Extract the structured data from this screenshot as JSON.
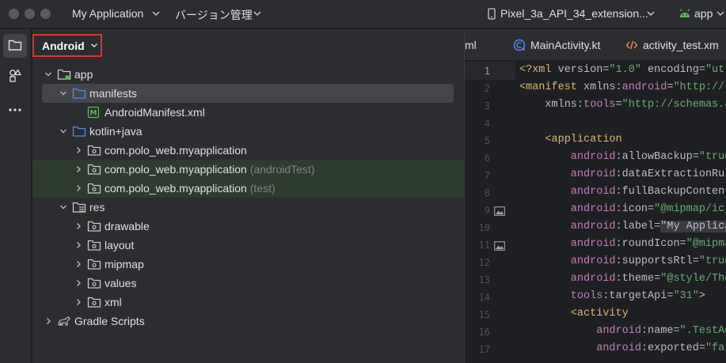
{
  "titlebar": {
    "project_name": "My Application",
    "vcs_label": "バージョン管理",
    "device": "Pixel_3a_API_34_extension...",
    "run_config": "app"
  },
  "project_panel": {
    "view_mode": "Android",
    "tree": [
      {
        "label": "app",
        "suffix": "",
        "indent": 0,
        "expanded": true,
        "icon": "module-folder-icon"
      },
      {
        "label": "manifests",
        "suffix": "",
        "indent": 1,
        "expanded": true,
        "icon": "folder-icon",
        "selected": true
      },
      {
        "label": "AndroidManifest.xml",
        "suffix": "",
        "indent": 2,
        "icon": "manifest-file-icon"
      },
      {
        "label": "kotlin+java",
        "suffix": "",
        "indent": 1,
        "expanded": true,
        "icon": "folder-icon"
      },
      {
        "label": "com.polo_web.myapplication",
        "suffix": "",
        "indent": 2,
        "expanded": false,
        "icon": "package-icon"
      },
      {
        "label": "com.polo_web.myapplication",
        "suffix": "(androidTest)",
        "indent": 2,
        "expanded": false,
        "icon": "package-icon",
        "test": true
      },
      {
        "label": "com.polo_web.myapplication",
        "suffix": "(test)",
        "indent": 2,
        "expanded": false,
        "icon": "package-icon",
        "test": true
      },
      {
        "label": "res",
        "suffix": "",
        "indent": 1,
        "expanded": true,
        "icon": "resource-folder-icon"
      },
      {
        "label": "drawable",
        "suffix": "",
        "indent": 2,
        "expanded": false,
        "icon": "package-icon"
      },
      {
        "label": "layout",
        "suffix": "",
        "indent": 2,
        "expanded": false,
        "icon": "package-icon"
      },
      {
        "label": "mipmap",
        "suffix": "",
        "indent": 2,
        "expanded": false,
        "icon": "package-icon"
      },
      {
        "label": "values",
        "suffix": "",
        "indent": 2,
        "expanded": false,
        "icon": "package-icon"
      },
      {
        "label": "xml",
        "suffix": "",
        "indent": 2,
        "expanded": false,
        "icon": "package-icon"
      },
      {
        "label": "Gradle Scripts",
        "suffix": "",
        "indent": 0,
        "expanded": false,
        "icon": "gradle-icon"
      }
    ]
  },
  "editor": {
    "tabs": [
      {
        "label": "ml",
        "icon": ""
      },
      {
        "label": "MainActivity.kt",
        "icon": "kotlin-class-icon"
      },
      {
        "label": "activity_test.xm",
        "icon": "xml-file-icon"
      }
    ],
    "current_line": "1",
    "lines": [
      {
        "n": "1",
        "tokens": [
          [
            "t",
            "<?xml "
          ],
          [
            "a",
            "version="
          ],
          [
            "s",
            "\"1.0\""
          ],
          [
            "a",
            " encoding="
          ],
          [
            "s",
            "\"utf"
          ]
        ]
      },
      {
        "n": "2",
        "tokens": [
          [
            "t",
            "<manifest "
          ],
          [
            "a",
            "xmlns:"
          ],
          [
            "n",
            "android"
          ],
          [
            "a",
            "="
          ],
          [
            "s",
            "\"http://s"
          ]
        ]
      },
      {
        "n": "3",
        "tokens": [
          [
            "a",
            "    xmlns:"
          ],
          [
            "n",
            "tools"
          ],
          [
            "a",
            "="
          ],
          [
            "s",
            "\"http://schemas.a"
          ]
        ]
      },
      {
        "n": "4",
        "tokens": []
      },
      {
        "n": "5",
        "tokens": [
          [
            "t",
            "    <application"
          ]
        ]
      },
      {
        "n": "6",
        "tokens": [
          [
            "n",
            "        android"
          ],
          [
            "a",
            ":allowBackup="
          ],
          [
            "s",
            "\"true"
          ]
        ]
      },
      {
        "n": "7",
        "tokens": [
          [
            "n",
            "        android"
          ],
          [
            "a",
            ":dataExtractionRul"
          ]
        ]
      },
      {
        "n": "8",
        "tokens": [
          [
            "n",
            "        android"
          ],
          [
            "a",
            ":fullBackupContent"
          ]
        ]
      },
      {
        "n": "9",
        "tokens": [
          [
            "n",
            "        android"
          ],
          [
            "a",
            ":icon="
          ],
          [
            "s",
            "\"@mipmap/ic_"
          ]
        ],
        "gutter_icon": true
      },
      {
        "n": "10",
        "tokens": [
          [
            "n",
            "        android"
          ],
          [
            "a",
            ":label="
          ],
          [
            "h",
            "\"My Applica"
          ]
        ]
      },
      {
        "n": "11",
        "tokens": [
          [
            "n",
            "        android"
          ],
          [
            "a",
            ":roundIcon="
          ],
          [
            "s",
            "\"@mipma"
          ]
        ],
        "gutter_icon": true
      },
      {
        "n": "12",
        "tokens": [
          [
            "n",
            "        android"
          ],
          [
            "a",
            ":supportsRtl="
          ],
          [
            "s",
            "\"true"
          ]
        ]
      },
      {
        "n": "13",
        "tokens": [
          [
            "n",
            "        android"
          ],
          [
            "a",
            ":theme="
          ],
          [
            "s",
            "\"@style/The"
          ]
        ]
      },
      {
        "n": "14",
        "tokens": [
          [
            "n",
            "        tools"
          ],
          [
            "a",
            ":targetApi="
          ],
          [
            "s",
            "\"31\""
          ],
          [
            "t",
            ">"
          ]
        ]
      },
      {
        "n": "15",
        "tokens": [
          [
            "t",
            "        <activity"
          ]
        ]
      },
      {
        "n": "16",
        "tokens": [
          [
            "n",
            "            android"
          ],
          [
            "a",
            ":name="
          ],
          [
            "s",
            "\".TestAc"
          ]
        ]
      },
      {
        "n": "17",
        "tokens": [
          [
            "n",
            "            android"
          ],
          [
            "a",
            ":exported="
          ],
          [
            "s",
            "\"fal"
          ]
        ]
      }
    ]
  }
}
